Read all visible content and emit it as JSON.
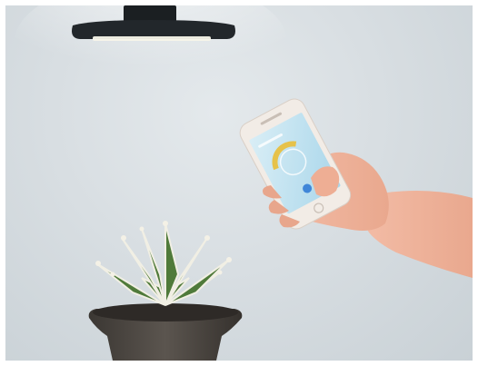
{
  "scene": {
    "subjects": [
      "pendant-lamp",
      "potted-succulent",
      "hand-holding-smartphone"
    ],
    "colors": {
      "wall": "#d8dee2",
      "lamp_shade": "#1e2226",
      "lamp_glow": "#f6f3e6",
      "plant_leaf": "#4f7a3a",
      "plant_tips": "#f1efe4",
      "pot": "#4a4540",
      "skin": "#f0b49c",
      "phone_body": "#f2ece6",
      "phone_screen": "#bfe0ef",
      "app_accent": "#3f86d8",
      "app_dial": "#e6c24a"
    }
  }
}
